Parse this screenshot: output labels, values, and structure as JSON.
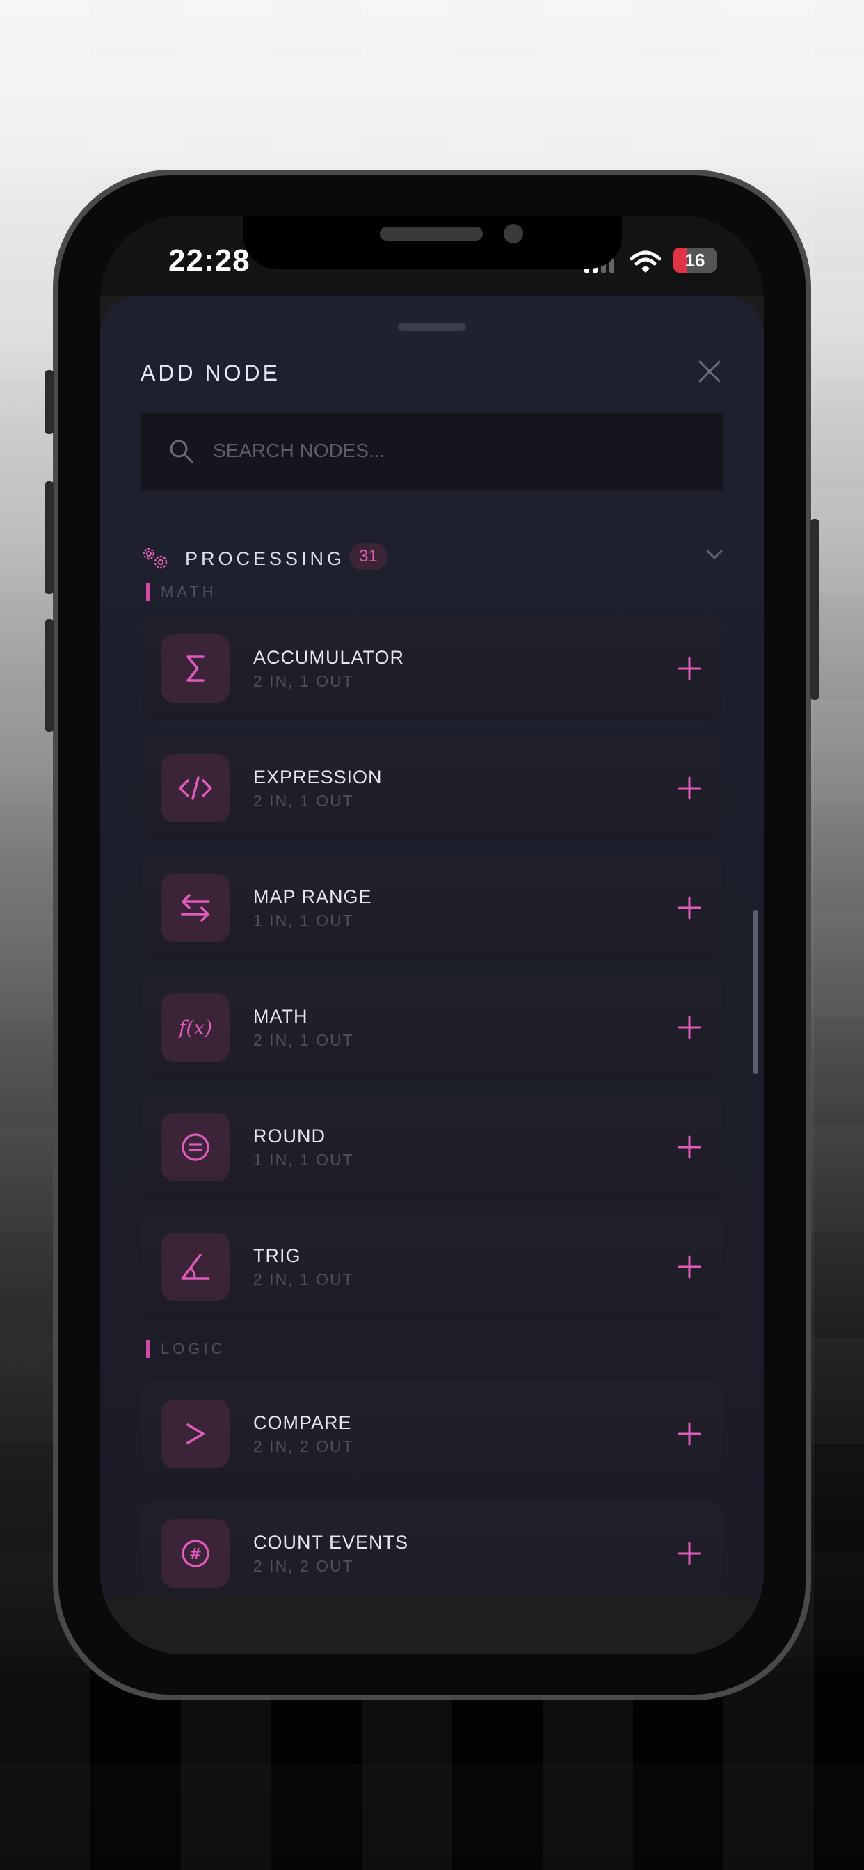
{
  "status_bar": {
    "time": "22:28",
    "battery": "16",
    "battery_level": 0.16
  },
  "sheet": {
    "title": "ADD NODE",
    "search_placeholder": "SEARCH NODES...",
    "category": {
      "name": "PROCESSING",
      "count": "31"
    },
    "groups": [
      {
        "label": "MATH",
        "items": [
          {
            "name": "ACCUMULATOR",
            "io": "2 IN, 1 OUT",
            "icon": "sigma-icon"
          },
          {
            "name": "EXPRESSION",
            "io": "2 IN, 1 OUT",
            "icon": "code-icon"
          },
          {
            "name": "MAP RANGE",
            "io": "1 IN, 1 OUT",
            "icon": "arrows-icon"
          },
          {
            "name": "MATH",
            "io": "2 IN, 1 OUT",
            "icon": "function-icon"
          },
          {
            "name": "ROUND",
            "io": "1 IN, 1 OUT",
            "icon": "equals-circle-icon"
          },
          {
            "name": "TRIG",
            "io": "2 IN, 1 OUT",
            "icon": "angle-icon"
          }
        ]
      },
      {
        "label": "LOGIC",
        "items": [
          {
            "name": "COMPARE",
            "io": "2 IN, 2 OUT",
            "icon": "greater-than-icon"
          },
          {
            "name": "COUNT EVENTS",
            "io": "2 IN, 2 OUT",
            "icon": "hash-circle-icon"
          }
        ]
      }
    ]
  },
  "colors": {
    "accent": "#e05bbd",
    "sheet_bg": "#1d1f2c",
    "icon_bg": "#3b2438"
  }
}
